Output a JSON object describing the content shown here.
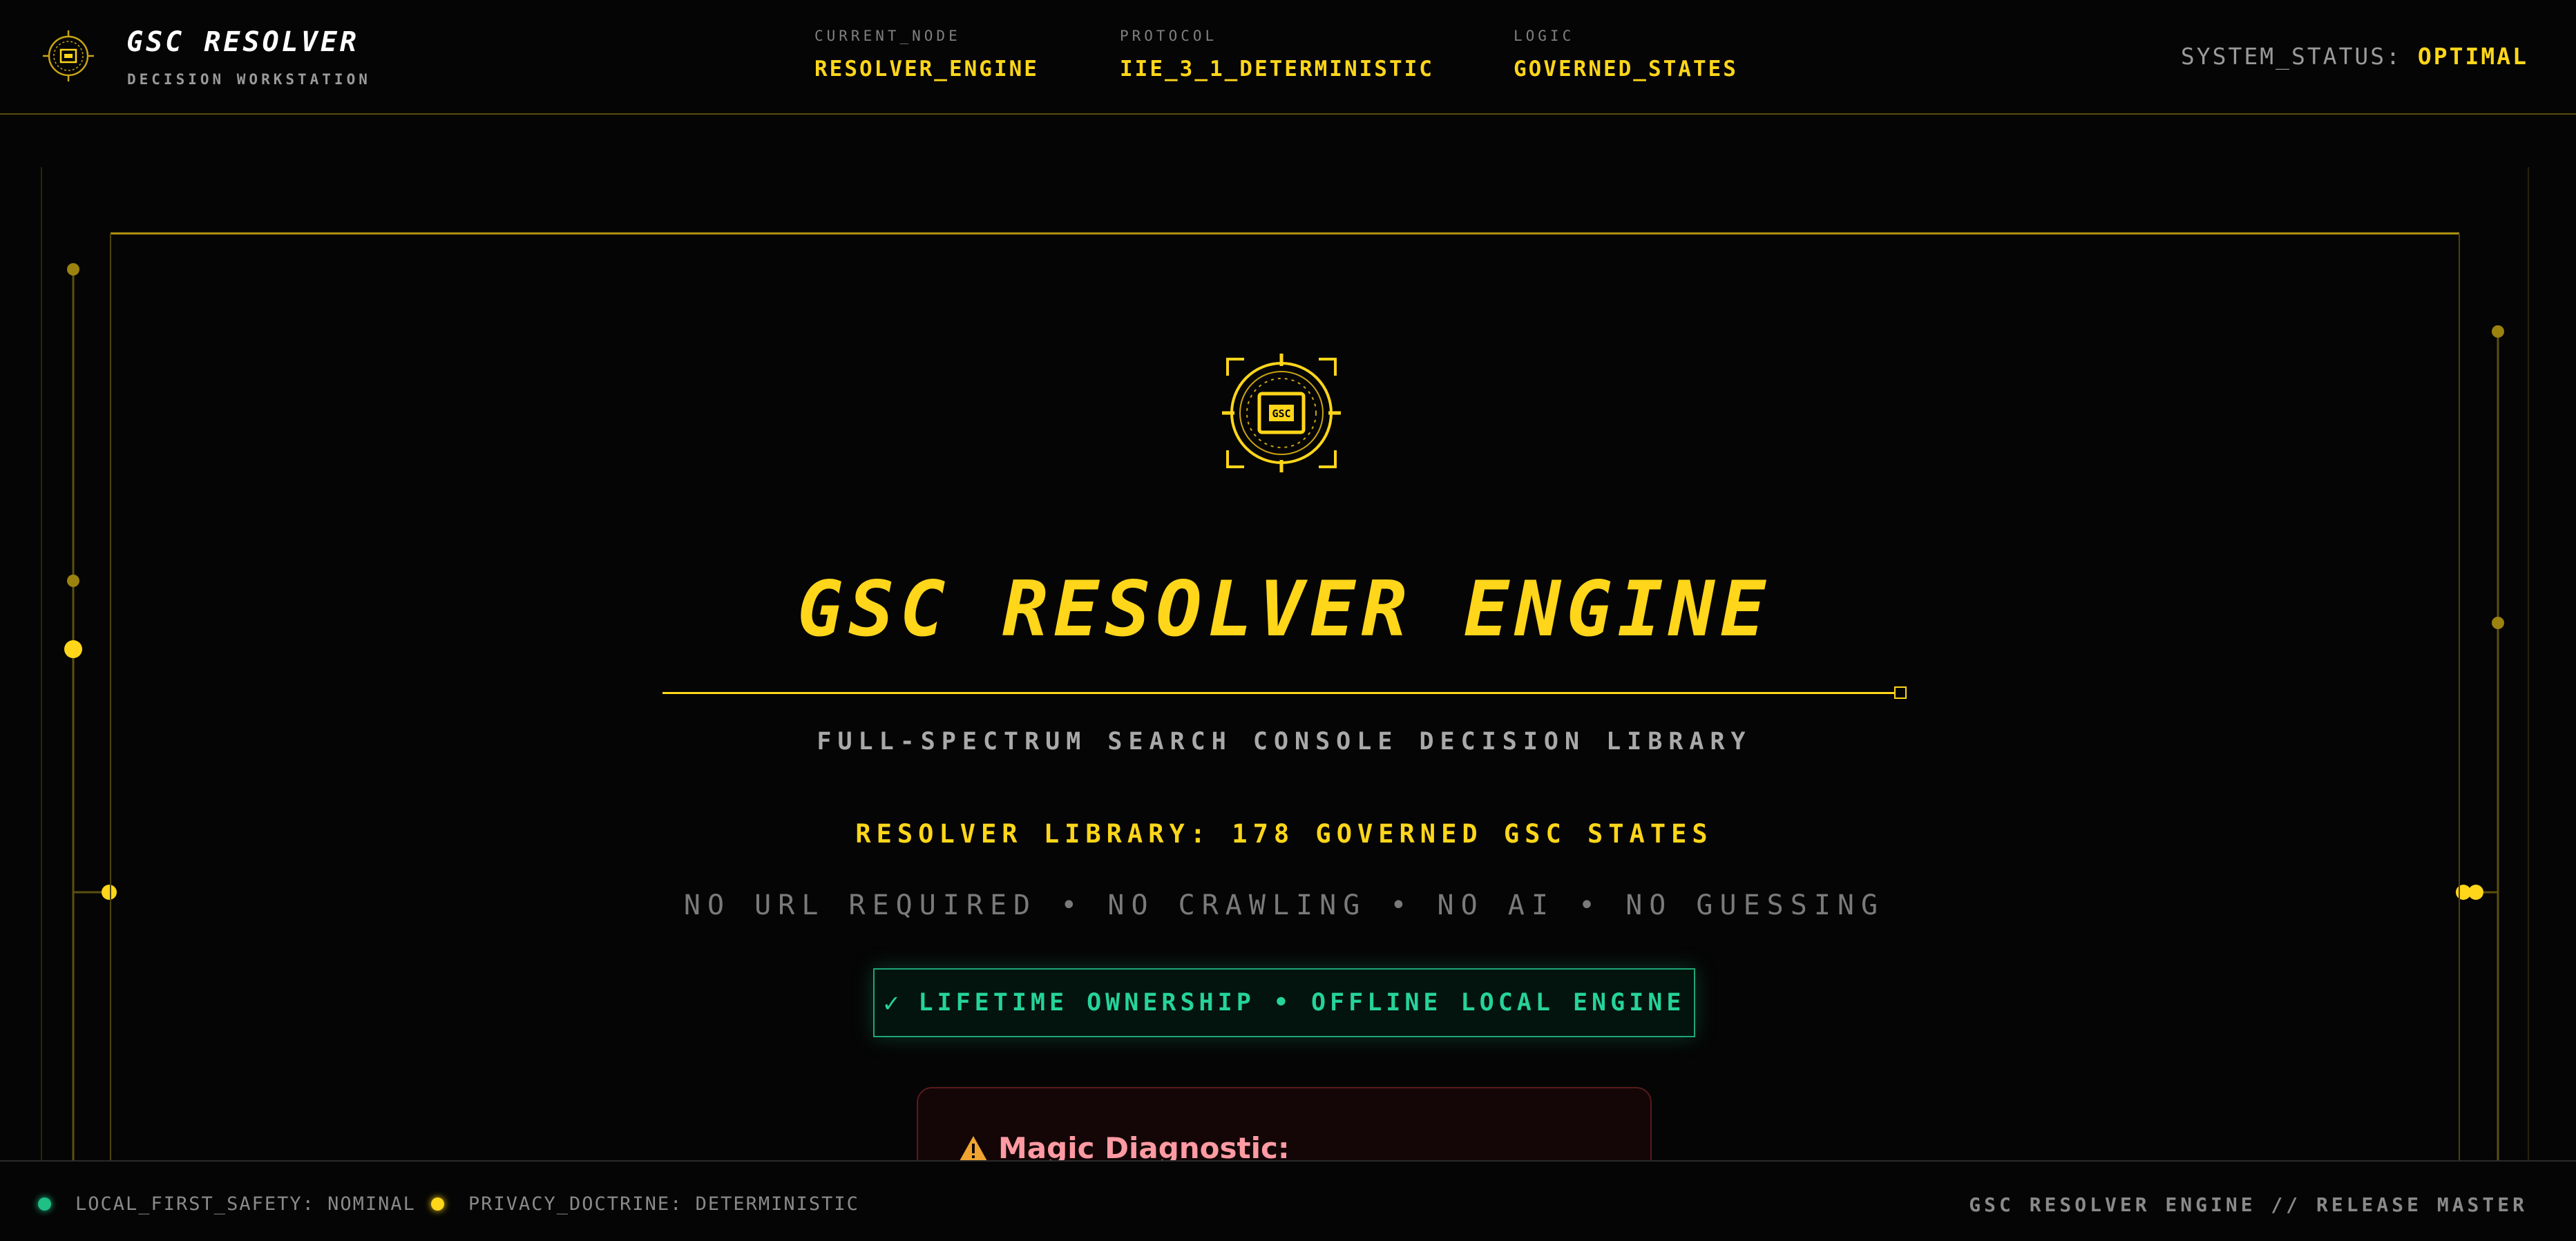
{
  "header": {
    "brand_title": "GSC RESOLVER",
    "brand_subtitle": "DECISION WORKSTATION",
    "meta": [
      {
        "label": "CURRENT_NODE",
        "value": "RESOLVER_ENGINE"
      },
      {
        "label": "PROTOCOL",
        "value": "IIE_3_1_DETERMINISTIC"
      },
      {
        "label": "LOGIC",
        "value": "GOVERNED_STATES"
      }
    ],
    "system_status_label": "SYSTEM_STATUS:",
    "system_status_value": "OPTIMAL"
  },
  "hero": {
    "emblem_text": "GSC",
    "title": "GSC RESOLVER ENGINE",
    "subtitle": "FULL-SPECTRUM SEARCH CONSOLE DECISION LIBRARY",
    "library_count": "RESOLVER LIBRARY: 178 GOVERNED GSC STATES",
    "tagline": "NO URL REQUIRED • NO CRAWLING • NO AI • NO GUESSING",
    "ownership_check": "✓",
    "ownership_text": "LIFETIME OWNERSHIP • OFFLINE LOCAL ENGINE",
    "diagnostic_title": "Magic Diagnostic:"
  },
  "footer": {
    "status_left_1": "LOCAL_FIRST_SAFETY: NOMINAL",
    "status_left_2": "PRIVACY_DOCTRINE: DETERMINISTIC",
    "release": "GSC RESOLVER ENGINE // RELEASE MASTER"
  },
  "colors": {
    "accent": "#ffd61a",
    "success": "#26d39a",
    "danger": "#ff9aa3",
    "background": "#050505"
  },
  "icons": [
    "chip-logo-icon",
    "chip-emblem-icon",
    "check-icon",
    "warning-icon",
    "status-dot-green",
    "status-dot-yellow"
  ]
}
